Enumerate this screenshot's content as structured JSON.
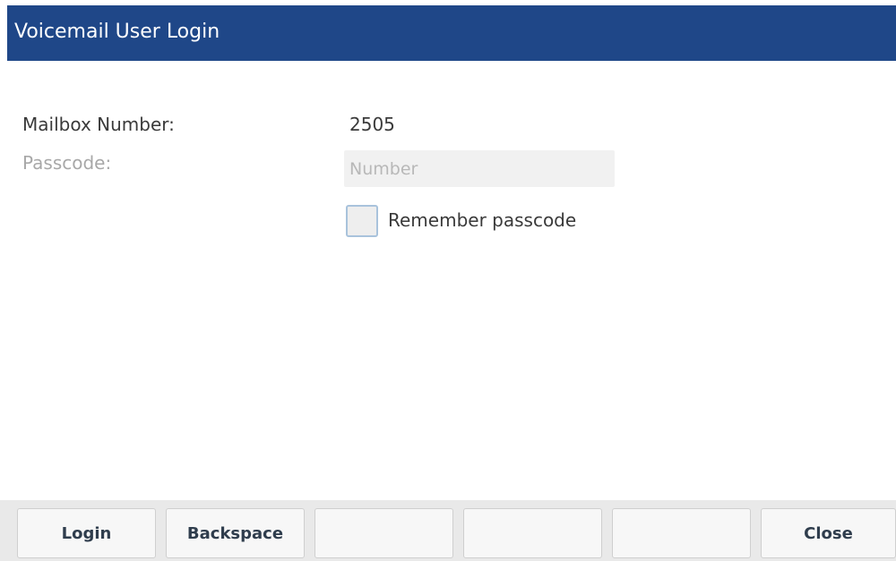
{
  "window": {
    "title": "Voicemail User Login"
  },
  "form": {
    "mailbox_label": "Mailbox Number:",
    "mailbox_value": "2505",
    "passcode_label": "Passcode:",
    "passcode_placeholder": "Number",
    "passcode_value": "",
    "remember_label": "Remember passcode",
    "remember_checked": false
  },
  "softkeys": [
    "Login",
    "Backspace",
    "",
    "",
    "",
    "Close"
  ],
  "colors": {
    "titlebar": "#1f4788",
    "softkey_bar": "#e9e9e9"
  }
}
